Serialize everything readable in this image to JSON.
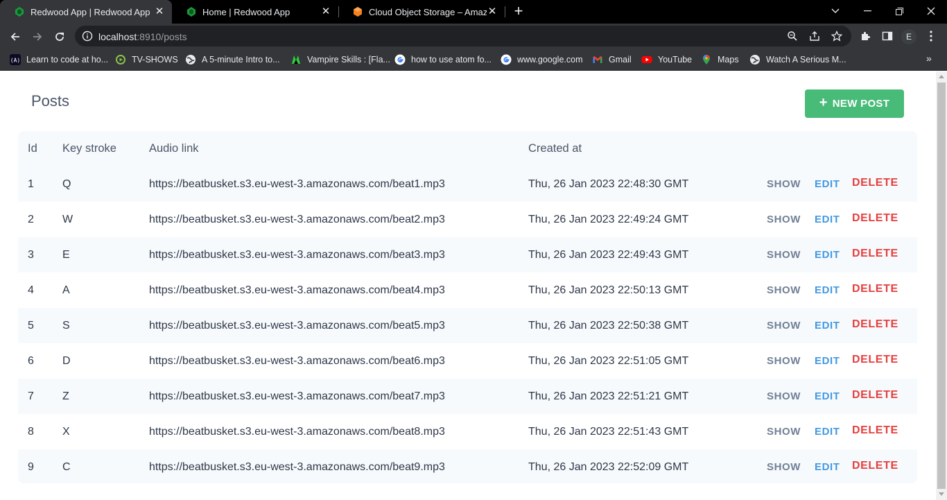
{
  "browser": {
    "tabs": [
      {
        "title": "Redwood App | Redwood App",
        "active": true,
        "icon": "redwood-icon"
      },
      {
        "title": "Home | Redwood App",
        "active": false,
        "icon": "redwood-icon"
      },
      {
        "title": "Cloud Object Storage – Amazon",
        "active": false,
        "icon": "aws-icon"
      }
    ],
    "url_host": "localhost",
    "url_rest": ":8910/posts",
    "profile_initial": "E",
    "bookmarks": [
      {
        "label": "Learn to code at ho...",
        "icon": "freecodecamp-icon"
      },
      {
        "label": "TV-SHOWS",
        "icon": "play-icon"
      },
      {
        "label": "A 5-minute Intro to...",
        "icon": "globe-icon"
      },
      {
        "label": "Vampire Skills : [Fla...",
        "icon": "vampire-icon"
      },
      {
        "label": "how to use atom fo...",
        "icon": "google-icon"
      },
      {
        "label": "www.google.com",
        "icon": "google-icon"
      },
      {
        "label": "Gmail",
        "icon": "gmail-icon"
      },
      {
        "label": "YouTube",
        "icon": "youtube-icon"
      },
      {
        "label": "Maps",
        "icon": "maps-icon"
      },
      {
        "label": "Watch A Serious M...",
        "icon": "globe-icon"
      }
    ],
    "bookmarks_more": "»"
  },
  "page": {
    "title": "Posts",
    "new_button": {
      "plus": "+",
      "label": "NEW POST"
    },
    "colors": {
      "new_button": "#48bb78",
      "show": "#718096",
      "edit": "#4299e1",
      "delete": "#e53e3e"
    },
    "table": {
      "headers": {
        "id": "Id",
        "key": "Key stroke",
        "audio": "Audio link",
        "created": "Created at"
      },
      "actions": {
        "show": "SHOW",
        "edit": "EDIT",
        "delete": "DELETE"
      },
      "rows": [
        {
          "id": "1",
          "key": "Q",
          "audio": "https://beatbusket.s3.eu-west-3.amazonaws.com/beat1.mp3",
          "created": "Thu, 26 Jan 2023 22:48:30 GMT"
        },
        {
          "id": "2",
          "key": "W",
          "audio": "https://beatbusket.s3.eu-west-3.amazonaws.com/beat2.mp3",
          "created": "Thu, 26 Jan 2023 22:49:24 GMT"
        },
        {
          "id": "3",
          "key": "E",
          "audio": "https://beatbusket.s3.eu-west-3.amazonaws.com/beat3.mp3",
          "created": "Thu, 26 Jan 2023 22:49:43 GMT"
        },
        {
          "id": "4",
          "key": "A",
          "audio": "https://beatbusket.s3.eu-west-3.amazonaws.com/beat4.mp3",
          "created": "Thu, 26 Jan 2023 22:50:13 GMT"
        },
        {
          "id": "5",
          "key": "S",
          "audio": "https://beatbusket.s3.eu-west-3.amazonaws.com/beat5.mp3",
          "created": "Thu, 26 Jan 2023 22:50:38 GMT"
        },
        {
          "id": "6",
          "key": "D",
          "audio": "https://beatbusket.s3.eu-west-3.amazonaws.com/beat6.mp3",
          "created": "Thu, 26 Jan 2023 22:51:05 GMT"
        },
        {
          "id": "7",
          "key": "Z",
          "audio": "https://beatbusket.s3.eu-west-3.amazonaws.com/beat7.mp3",
          "created": "Thu, 26 Jan 2023 22:51:21 GMT"
        },
        {
          "id": "8",
          "key": "X",
          "audio": "https://beatbusket.s3.eu-west-3.amazonaws.com/beat8.mp3",
          "created": "Thu, 26 Jan 2023 22:51:43 GMT"
        },
        {
          "id": "9",
          "key": "C",
          "audio": "https://beatbusket.s3.eu-west-3.amazonaws.com/beat9.mp3",
          "created": "Thu, 26 Jan 2023 22:52:09 GMT"
        }
      ]
    }
  }
}
